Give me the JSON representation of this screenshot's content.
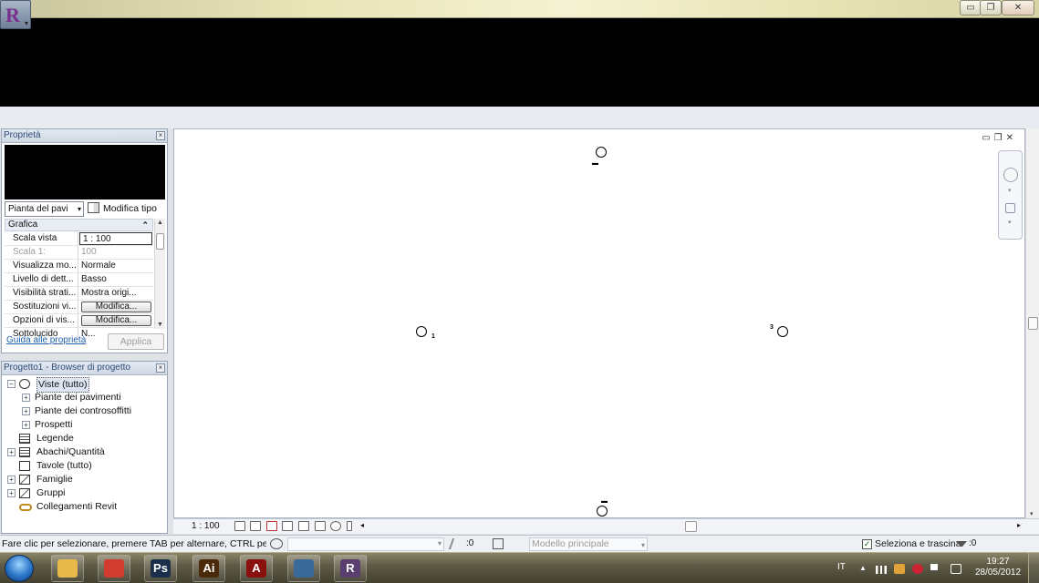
{
  "window": {
    "title": "",
    "controls": {
      "minimize": "▭",
      "restore": "❐",
      "close": "✕"
    }
  },
  "app_button": {
    "logo": "R",
    "arrow": "▾"
  },
  "properties": {
    "header": "Proprietà",
    "close": "×",
    "type_selector": "Pianta del pavi",
    "type_selector_arrow": "▾",
    "edit_type": "Modifica tipo",
    "group": "Grafica",
    "group_collapse": "⌃",
    "rows": [
      {
        "name": "Scala vista",
        "value": "1 : 100",
        "kind": "edit"
      },
      {
        "name": "Scala  1:",
        "value": "100",
        "kind": "disabled"
      },
      {
        "name": "Visualizza mo...",
        "value": "Normale",
        "kind": "text"
      },
      {
        "name": "Livello di dett...",
        "value": "Basso",
        "kind": "text"
      },
      {
        "name": "Visibilità strati...",
        "value": "Mostra origi...",
        "kind": "text"
      },
      {
        "name": "Sostituzioni vi...",
        "value": "Modifica...",
        "kind": "button"
      },
      {
        "name": "Opzioni di vis...",
        "value": "Modifica...",
        "kind": "button"
      },
      {
        "name": "Sottolucido",
        "value": "N...",
        "kind": "text"
      }
    ],
    "help_link": "Guida alle proprietà",
    "apply": "Applica"
  },
  "browser": {
    "header": "Progetto1 - Browser di progetto",
    "close": "×",
    "tree": [
      {
        "label": "Viste (tutto)",
        "indent": 0,
        "expander": "⊟",
        "icon": "views",
        "selected": true
      },
      {
        "label": "Piante dei pavimenti",
        "indent": 1,
        "expander": "⊞"
      },
      {
        "label": "Piante dei controsoffitti",
        "indent": 1,
        "expander": "⊞"
      },
      {
        "label": "Prospetti",
        "indent": 1,
        "expander": "⊞"
      },
      {
        "label": "Legende",
        "indent": 0,
        "expander": "",
        "icon": "table"
      },
      {
        "label": "Abachi/Quantità",
        "indent": 0,
        "expander": "⊞",
        "icon": "table"
      },
      {
        "label": "Tavole (tutto)",
        "indent": 0,
        "expander": "",
        "icon": "sheet"
      },
      {
        "label": "Famiglie",
        "indent": 0,
        "expander": "⊞",
        "icon": "fam"
      },
      {
        "label": "Gruppi",
        "indent": 0,
        "expander": "⊞",
        "icon": "fam"
      },
      {
        "label": "Collegamenti Revit",
        "indent": 0,
        "expander": "",
        "icon": "link"
      }
    ]
  },
  "canvas": {
    "view_controls": "▭❐✕",
    "markers": {
      "top": "▬",
      "left": "1",
      "right": "3",
      "bottom": "▬"
    },
    "scrollbar": {
      "down": "▾"
    }
  },
  "viewbar": {
    "scale": "1 : 100",
    "scroll_left": "◂",
    "scroll_right": "▸"
  },
  "statusbar": {
    "text": "Fare clic per selezionare, premere TAB per alternare, CTRL per aggi",
    "count": ":0",
    "model": "Modello principale",
    "combo_arrow": "▾",
    "drag_check": "✓",
    "drag_label": "Seleziona e trascina",
    "filter_count": ":0"
  },
  "taskbar": {
    "apps": [
      {
        "name": "explorer",
        "glyph": "",
        "color": "#e6b94a"
      },
      {
        "name": "chrome",
        "glyph": "",
        "color": "#d23b2f"
      },
      {
        "name": "photoshop",
        "glyph": "Ps",
        "color": "#1b2f4a"
      },
      {
        "name": "illustrator",
        "glyph": "Ai",
        "color": "#4a2a0a"
      },
      {
        "name": "acrobat",
        "glyph": "A",
        "color": "#8a1010"
      },
      {
        "name": "monitor",
        "glyph": "",
        "color": "#3a6a9a"
      },
      {
        "name": "revit",
        "glyph": "R",
        "color": "#5a3f6f"
      }
    ],
    "language": "IT",
    "time": "19:27",
    "date": "28/05/2012"
  }
}
